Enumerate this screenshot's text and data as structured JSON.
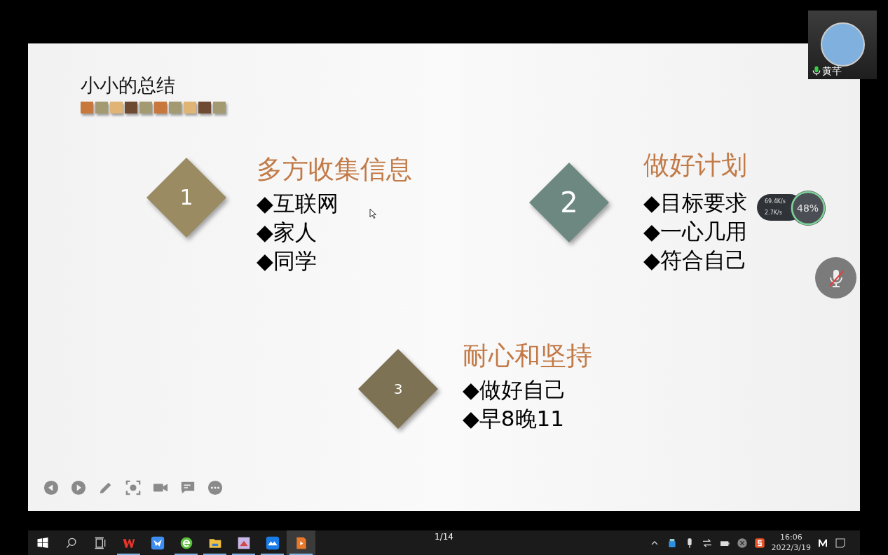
{
  "slide": {
    "title": "小小的总结",
    "swatches": [
      {
        "color": "#c8773d"
      },
      {
        "color": "#a39a72"
      },
      {
        "color": "#e0b474"
      },
      {
        "color": "#6e4a32"
      },
      {
        "color": "#a39a72"
      },
      {
        "color": "#c8773d"
      },
      {
        "color": "#a39a72"
      },
      {
        "color": "#e0b474"
      },
      {
        "color": "#6e4a32"
      },
      {
        "color": "#a39a72"
      }
    ],
    "sections": [
      {
        "number": "1",
        "color": "#9a8b62",
        "heading": "多方收集信息",
        "bullets": [
          "◆互联网",
          "◆家人",
          "◆同学"
        ]
      },
      {
        "number": "2",
        "color": "#6c8880",
        "heading": "做好计划",
        "bullets": [
          "◆目标要求",
          "◆一心几用",
          "◆符合自己"
        ]
      },
      {
        "number": "3",
        "color": "#7e7254",
        "heading": "耐心和坚持",
        "bullets": [
          "◆做好自己",
          "◆早8晚11"
        ]
      }
    ]
  },
  "player_toolbar": [
    {
      "kind": "previous"
    },
    {
      "kind": "next"
    },
    {
      "kind": "pen"
    },
    {
      "kind": "screenshot"
    },
    {
      "kind": "camera"
    },
    {
      "kind": "chat"
    },
    {
      "kind": "more"
    }
  ],
  "page_counter": "1/14",
  "participant": {
    "name": "黄芊",
    "mic_on": true
  },
  "speed_meter": {
    "upload": "69.4K/s",
    "download": "2.7K/s",
    "percent": "48%"
  },
  "mic_button": {
    "muted": true
  },
  "taskbar": {
    "apps": [
      {
        "kind": "wps",
        "running": true,
        "selected": false
      },
      {
        "kind": "bird",
        "running": false,
        "selected": false
      },
      {
        "kind": "browser",
        "running": true,
        "selected": false
      },
      {
        "kind": "folder",
        "running": true,
        "selected": false
      },
      {
        "kind": "book",
        "running": true,
        "selected": false
      },
      {
        "kind": "cloud",
        "running": true,
        "selected": false
      },
      {
        "kind": "slides",
        "running": true,
        "selected": true
      }
    ],
    "time": "16:06",
    "date": "2022/3/19"
  }
}
